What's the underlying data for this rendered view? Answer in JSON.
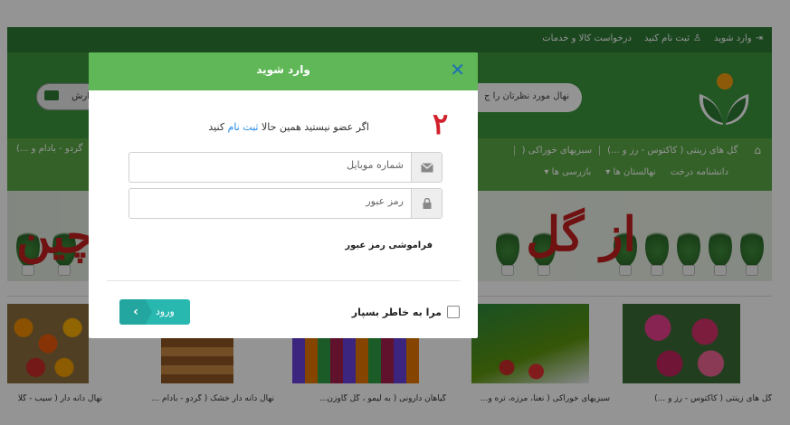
{
  "topbar": {
    "login": "وارد شوید",
    "register": "ثبت نام کنید",
    "request": "درخواست کالا و خدمات"
  },
  "header": {
    "search_text": "نهال مورد نظرتان را ج",
    "order_label": "ارش"
  },
  "nav": {
    "row1": [
      "گل های زینتی ( کاکتوس - رز و ...)",
      "سبزیهای خوراکی ("
    ],
    "row1_left": "گردو - بادام و ...)",
    "row2": [
      "دانشنامه درخت",
      "نهالستان ها ▾",
      "بازرسی ها ▾"
    ]
  },
  "banner": {
    "text_right": "از گل",
    "text_left": "چین"
  },
  "products": [
    {
      "caption": "گل های زینتی ( کاکتوس - رز و ...)"
    },
    {
      "caption": "سبزیهای خوراکی ( نعنا، مرزه، تره و..."
    },
    {
      "caption": "گیاهان دارونی ( به لیمو ، گل گاوزن..."
    },
    {
      "caption": "نهال دانه دار خشک ( گردو - بادام ..."
    },
    {
      "caption": "نهال دانه دار ( سیب - گلا"
    }
  ],
  "modal": {
    "title": "وارد شوید",
    "close": "✕",
    "step_number": "۲",
    "prompt_prefix": "اگر عضو نیستید همین حالا",
    "prompt_link": "ثبت نام",
    "prompt_suffix": "کنید",
    "mobile_placeholder": "شماره موبایل",
    "password_placeholder": "رمز عبور",
    "forgot": "فراموشی رمز عبور",
    "remember": "مرا به خاطر بسپار",
    "login_button": "ورود"
  },
  "colors": {
    "header_green": "#3c963f",
    "modal_header": "#5fb757",
    "login_button": "#28b8b0",
    "step_number": "#d11f2b",
    "link_blue": "#1e88e5"
  }
}
